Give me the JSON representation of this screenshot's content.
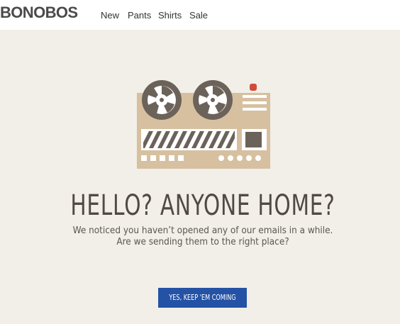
{
  "header": {
    "logo": "BONOBOS",
    "nav": [
      {
        "label": "New"
      },
      {
        "label": "Pants"
      },
      {
        "label": "Shirts"
      },
      {
        "label": "Sale"
      }
    ]
  },
  "hero": {
    "icon": "tape-recorder-icon",
    "headline": "HELLO? ANYONE HOME?",
    "message_lines": [
      "We noticed you haven’t opened any of our emails in a while.",
      "Are we sending them to the right place?"
    ],
    "cta_label": "YES, KEEP 'EM COMING"
  },
  "colors": {
    "background": "#f1efe8",
    "header_background": "#ffffff",
    "recorder_body": "#d6c0a0",
    "recorder_dark": "#6b625a",
    "recorder_light": "#ffffff",
    "indicator": "#d24a3a",
    "headline_text": "#514a43",
    "cta_background": "#2452a5",
    "cta_text": "#ffffff"
  }
}
